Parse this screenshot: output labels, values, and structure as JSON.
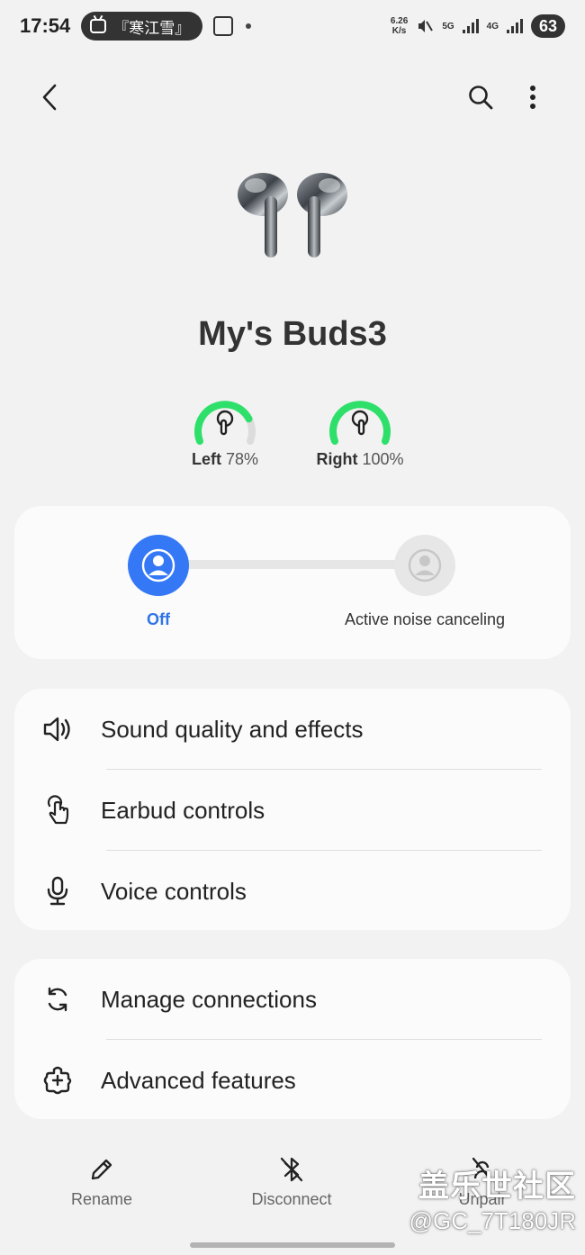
{
  "status_bar": {
    "time": "17:54",
    "media_title": "『寒江雪』",
    "net_speed_value": "6.26",
    "net_speed_unit": "K/s",
    "network_5g": "5G",
    "network_4g": "4G",
    "battery": "63"
  },
  "app_bar": {
    "icons": [
      "back-icon",
      "search-icon",
      "more-vertical-icon"
    ]
  },
  "device": {
    "name": "My's Buds3"
  },
  "battery_levels": {
    "left": {
      "label": "Left",
      "value": "78%",
      "fraction": 0.78
    },
    "right": {
      "label": "Right",
      "value": "100%",
      "fraction": 1.0
    }
  },
  "noise_control": {
    "options": [
      {
        "label": "Off",
        "active": true
      },
      {
        "label": "Active noise canceling",
        "active": false
      }
    ]
  },
  "menu_group_1": [
    {
      "label": "Sound quality and effects",
      "icon": "speaker-icon"
    },
    {
      "label": "Earbud controls",
      "icon": "touch-icon"
    },
    {
      "label": "Voice controls",
      "icon": "microphone-icon"
    }
  ],
  "menu_group_2": [
    {
      "label": "Manage connections",
      "icon": "sync-icon"
    },
    {
      "label": "Advanced features",
      "icon": "puzzle-icon"
    }
  ],
  "bottom_actions": [
    {
      "label": "Rename",
      "icon": "pencil-icon"
    },
    {
      "label": "Disconnect",
      "icon": "bluetooth-off-icon"
    },
    {
      "label": "Unpair",
      "icon": "unpair-icon"
    }
  ],
  "watermark": {
    "line1": "盖乐世社区",
    "line2": "@GC_7T180JR"
  },
  "colors": {
    "accent": "#3478f6",
    "battery_green": "#2ee06a",
    "background": "#f2f2f2",
    "card": "#fbfbfb"
  }
}
